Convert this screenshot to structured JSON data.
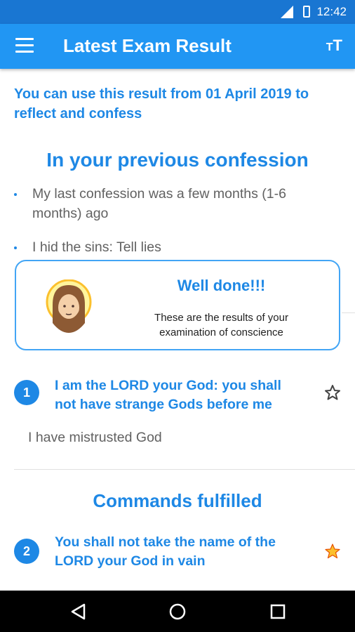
{
  "status_bar": {
    "time": "12:42",
    "network": "LTE"
  },
  "app_bar": {
    "title": "Latest Exam Result",
    "menu_icon": "hamburger-menu-icon",
    "text_size_icon": "text-size-icon",
    "text_size_small": "T",
    "text_size_large": "T"
  },
  "intro_text": "You can use this result from 01 April 2019 to reflect and confess",
  "previous_confession": {
    "heading": "In your previous confession",
    "items": [
      "My last confession was a few months (1-6 months) ago",
      "I hid the sins: Tell lies"
    ]
  },
  "result_card": {
    "title": "Well done!!!",
    "message": "These are the results of your examination of conscience",
    "avatar_icon": "jesus-avatar-icon"
  },
  "commandments": [
    {
      "number": "1",
      "text": "I am the LORD your God: you shall not have strange Gods before me",
      "starred": false,
      "sin": "I have mistrusted God"
    }
  ],
  "fulfilled": {
    "heading": "Commands fulfilled",
    "items": [
      {
        "number": "2",
        "text": "You shall not take the name of the LORD your God in vain",
        "starred": true
      }
    ]
  },
  "colors": {
    "primary": "#2196f3",
    "accent_text": "#1e88e5",
    "star_gold": "#fbc02d"
  }
}
